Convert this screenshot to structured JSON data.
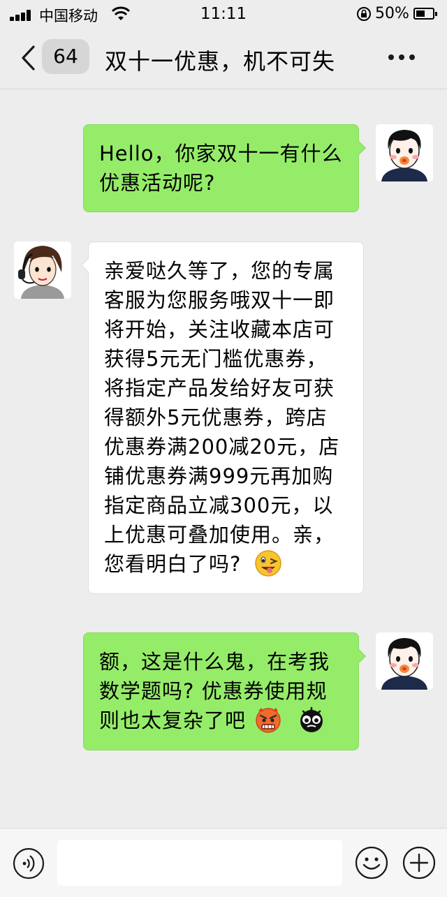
{
  "status_bar": {
    "carrier": "中国移动",
    "time": "11:11",
    "battery_percent": "50%",
    "battery_level": 0.5
  },
  "nav": {
    "unread_count": "64",
    "title": "双十一优惠，机不可失",
    "icons": {
      "back": "chevron-left-icon",
      "more": "more-dots-icon"
    }
  },
  "messages": [
    {
      "sender": "me",
      "text": "Hello，你家双十一有什么优惠活动呢?"
    },
    {
      "sender": "them",
      "text": "亲爱哒久等了，您的专属客服为您服务哦双十一即将开始，关注收藏本店可获得5元无门槛优惠券，将指定产品发给好友可获得额外5元优惠券，跨店优惠券满200减20元，店铺优惠券满999元再加购指定商品立减300元，以上优惠可叠加使用。亲，您看明白了吗?",
      "emoji": "wink-tongue-emoji"
    },
    {
      "sender": "me",
      "text": "额，这是什么鬼，在考我数学题吗? 优惠券使用规则也太复杂了吧",
      "emojis": [
        "angry-face-emoji",
        "black-bomb-face-emoji"
      ]
    }
  ],
  "input_bar": {
    "placeholder": "",
    "icons": {
      "voice": "voice-icon",
      "emoji": "smiley-icon",
      "more": "plus-icon"
    }
  },
  "colors": {
    "background": "#ededed",
    "my_bubble": "#95ec69",
    "their_bubble": "#ffffff"
  }
}
